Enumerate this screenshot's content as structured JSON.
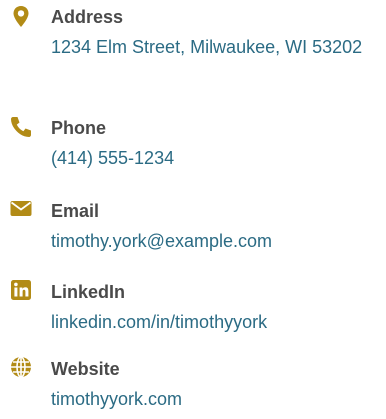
{
  "colors": {
    "accent": "#b28b16",
    "label": "#4a4a4a",
    "link": "#2b6b84"
  },
  "contact": {
    "address": {
      "icon": "map-pin-icon",
      "label": "Address",
      "value": "1234 Elm Street, Milwaukee, WI 53202"
    },
    "phone": {
      "icon": "phone-icon",
      "label": "Phone",
      "value": "(414) 555-1234"
    },
    "email": {
      "icon": "envelope-icon",
      "label": "Email",
      "value": "timothy.york@example.com"
    },
    "linkedin": {
      "icon": "linkedin-icon",
      "label": "LinkedIn",
      "value": "linkedin.com/in/timothyyork"
    },
    "website": {
      "icon": "globe-icon",
      "label": "Website",
      "value": "timothyyork.com"
    }
  }
}
